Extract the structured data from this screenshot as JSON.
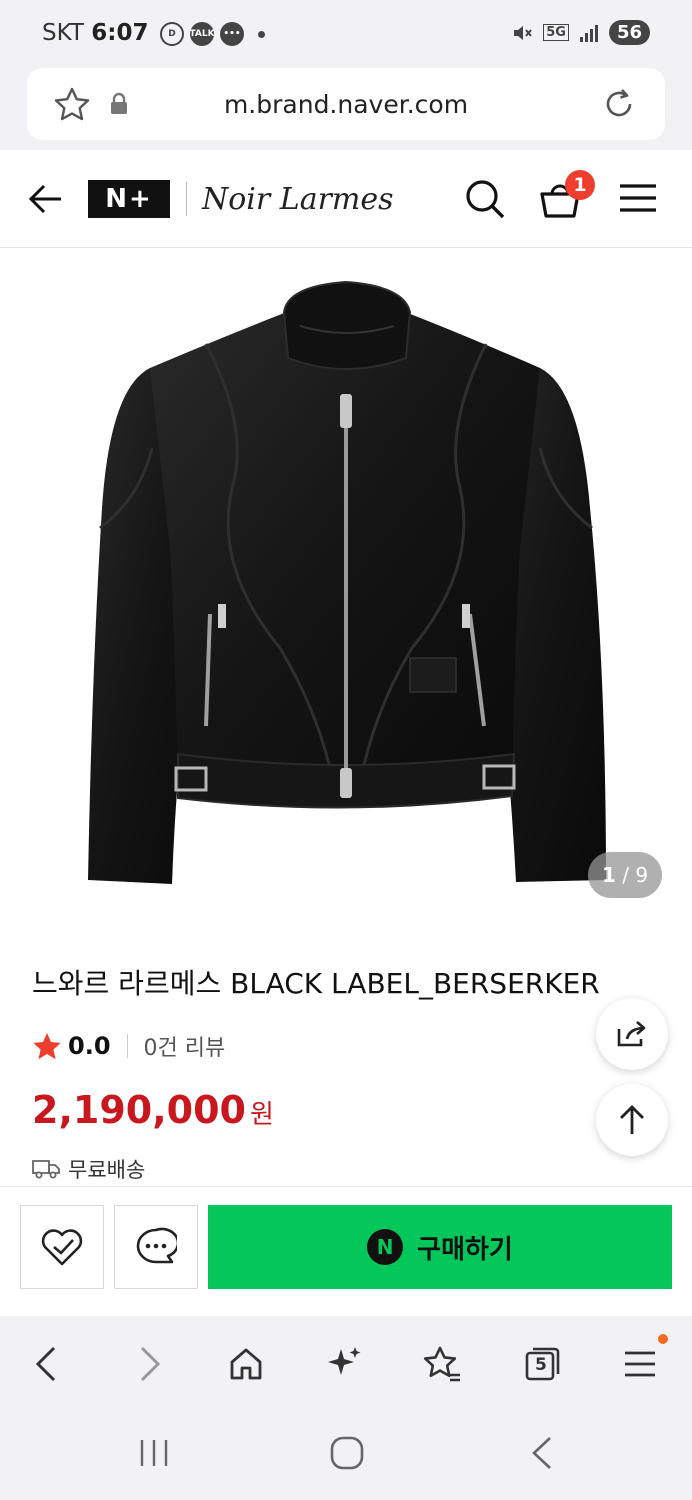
{
  "status_bar": {
    "carrier": "SKT",
    "time": "6:07",
    "talk_label": "TALK",
    "network": "5G",
    "battery": "56"
  },
  "browser": {
    "url": "m.brand.naver.com",
    "tab_count": "5"
  },
  "header": {
    "logo": "N+",
    "brand_name": "Noir Larmes",
    "cart_count": "1"
  },
  "gallery": {
    "current": "1",
    "separator": " / ",
    "total": "9"
  },
  "product": {
    "title": "느와르 라르메스 BLACK LABEL_BERSERKER",
    "rating": "0.0",
    "review_count": "0건 리뷰",
    "price": "2,190,000",
    "currency": "원",
    "shipping": "무료배송"
  },
  "actions": {
    "buy_label": "구매하기",
    "buy_icon_letter": "N"
  },
  "colors": {
    "accent_green": "#03c75a",
    "price_red": "#c9171e",
    "star": "#f03e2e",
    "badge_red": "#f03e2e"
  }
}
